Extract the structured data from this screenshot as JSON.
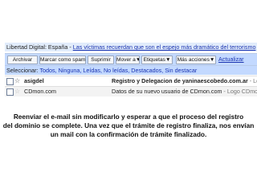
{
  "ad_bar": {
    "source": "Libertad Digital: España",
    "separator": "-",
    "link": "Las víctimas recuerdan que son el espejo más dramático del terrorismo"
  },
  "toolbar": {
    "archive": "Archivar",
    "not_spam": "Marcar como spam",
    "delete": "Suprimir",
    "move": "Mover a▼",
    "labels": "Etiquetas▼",
    "more": "Más acciones▼",
    "refresh": "Actualizar"
  },
  "select_bar": {
    "prefix": "Seleccionar:",
    "options": "Todos, Ninguna, Leídas, No leídas, Destacados, Sin destacar"
  },
  "messages": [
    {
      "sender": "asigdel",
      "subject": "Registro y Delegacion de yaninaescobedo.com.ar",
      "snippet": " - Logo CDmo",
      "unread": true
    },
    {
      "sender": "CDmon.com",
      "subject": "Datos de su nuevo usuario de CDmon.com",
      "snippet": " - Logo CDmo",
      "unread": false
    }
  ],
  "caption": [
    "Reenviar el e-mail sin modificarlo y esperar a que el proceso del registro",
    "del dominio se complete. Una vez que el trámite de registro finaliza, nos envían",
    "un mail con la confirmación de trámite finalizado."
  ]
}
